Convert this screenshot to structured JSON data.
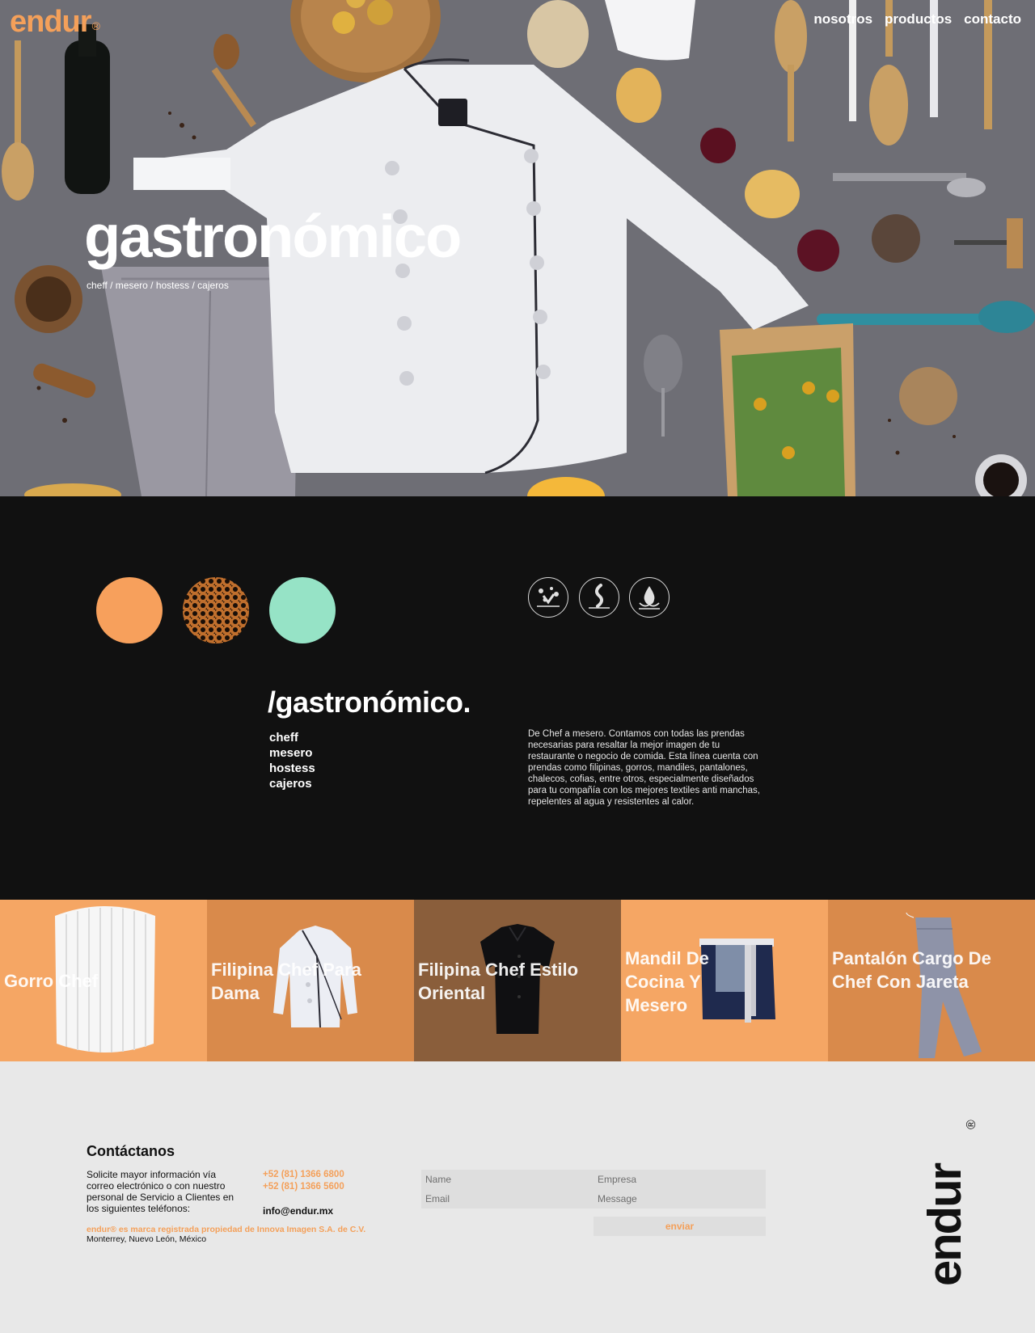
{
  "header": {
    "logo": "endur",
    "logo_mark": "®",
    "nav": [
      "nosotros",
      "productos",
      "contacto"
    ]
  },
  "hero": {
    "title": "gastronómico",
    "subtitle": "cheff / mesero / hostess / cajeros"
  },
  "swatches": [
    "#f7a05c",
    "pattern-brown",
    "#96e3c6"
  ],
  "features": [
    "stain-resistant-icon",
    "heat-resistant-icon",
    "water-repellent-icon"
  ],
  "section": {
    "title": "/gastronómico.",
    "roles": [
      "cheff",
      "mesero",
      "hostess",
      "cajeros"
    ],
    "description": "De Chef a mesero. Contamos con todas las prendas necesarias para resaltar la mejor imagen de tu restaurante o negocio de comida. Esta línea cuenta con prendas como filipinas, gorros, mandiles, pantalones, chalecos, cofias, entre otros, especialmente diseñados para tu compañía con los mejores textiles anti manchas, repelentes al agua y resistentes al calor."
  },
  "products": [
    {
      "name": "Gorro Chef",
      "bg": "#f5a664"
    },
    {
      "name": "Filipina Chef Para Dama",
      "bg": "#d98a4b"
    },
    {
      "name": "Filipina Chef Estilo Oriental",
      "bg": "#8a5e3b"
    },
    {
      "name": "Mandil De Cocina Y Mesero",
      "bg": "#f5a664"
    },
    {
      "name": "Pantalón Cargo De Chef Con Jareta",
      "bg": "#d98a4b"
    }
  ],
  "contact": {
    "title": "Contáctanos",
    "text": "Solicite mayor información vía correo electrónico o con nuestro personal de Servicio a Clientes en los siguientes teléfonos:",
    "phone1": "+52 (81) 1366 6800",
    "phone2": "+52 (81) 1366 5600",
    "email": "info@endur.mx",
    "legal": "endur® es marca registrada propiedad de Innova Imagen S.A. de C.V.",
    "address": "Monterrey, Nuevo León, México"
  },
  "form": {
    "name_placeholder": "Name",
    "company_placeholder": "Empresa",
    "email_placeholder": "Email",
    "message_placeholder": "Message",
    "submit": "enviar"
  },
  "footer_logo": "endur",
  "footer_logo_mark": "®"
}
